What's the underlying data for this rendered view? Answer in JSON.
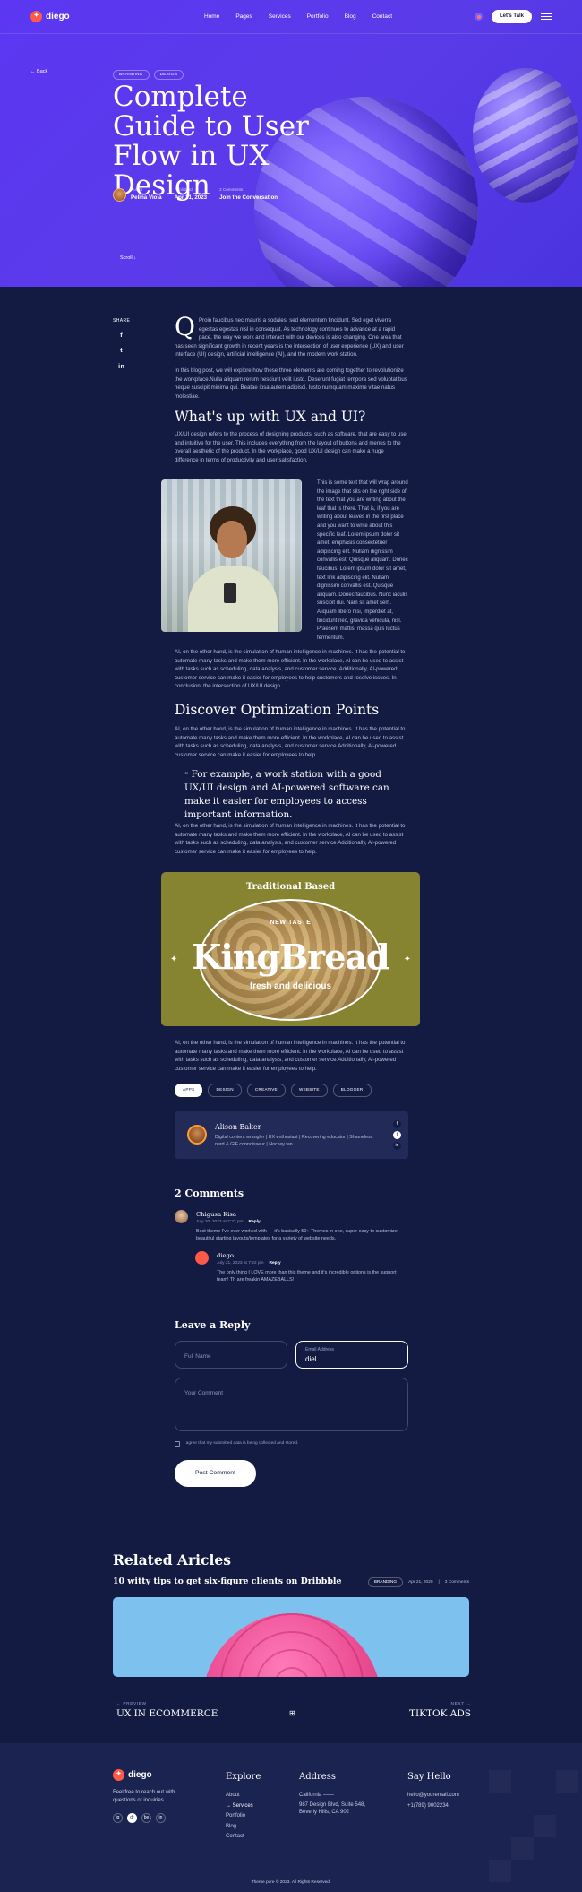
{
  "nav": {
    "logo": "diego",
    "links": [
      "Home",
      "Pages",
      "Services",
      "Portfolio",
      "Blog",
      "Contact"
    ],
    "cta": "Let's Talk"
  },
  "hero": {
    "back": "Back",
    "tags": [
      "BRANDING",
      "DESIGN"
    ],
    "title": "Complete Guide to User Flow in UX Design",
    "author_label": "Author",
    "author": "Pelina Viola",
    "published_label": "Published",
    "published": "Apr 21, 2023",
    "comments_label": "2 Comments",
    "comments_cta": "Join the Conversation",
    "scroll": "Scroll"
  },
  "article": {
    "share_label": "SHARE",
    "intro_dropcap": "Q",
    "intro": "Proin faucibus nec mauris a sodales, sed elementum tincidunt. Sed eget viverra egestas egestas nisl in consequat. As technology continues to advance at a rapid pace, the way we work and interact with our devices is also changing. One area that has seen significant growth in recent years is the intersection of user experience (UX) and user interface (UI) design, artificial intelligence (AI), and the modern work station.",
    "p2": "In this blog post, we will explore how these three elements are coming together to revolutionize the workplace.Nulla aliquam rerum nesciunt velit iusto. Deserunt fugiat tempora sed voluptatibus neque suscipit minima qui. Beatae ipsa autem adipisci. Iusto numquam maxime vitae natus molestiae.",
    "h2_1": "What's up with UX and UI?",
    "p3": "UX/UI design refers to the process of designing products, such as software, that are easy to use and intuitive for the user. This includes everything from the layout of buttons and menus to the overall aesthetic of the product. In the workplace, good UX/UI design can make a huge difference in terms of productivity and user satisfaction.",
    "float_text": "This is some text that will wrap around the image that sits on the right side of the text that you are writing about the leaf that is there. That is, if you are writing about leaves in the first place and you want to write about this specific leaf. Lorem ipsum dolor sit amet, emphasis consectetuer adipiscing elit. Nullam dignissim convallis est. Quisque aliquam. Donec faucibus. Lorem ipsum dolor sit amet, text link adipiscing elit. Nullam dignissim convallis est. Quisque aliquam. Donec faucibus. Nunc iaculis suscipit dui. Nam sit amet sem. Aliquam libero nisi, imperdiet at, tincidunt nec, gravida vehicula, nisl. Praesent mattis, massa quis luctus fermentum.",
    "p4": "AI, on the other hand, is the simulation of human intelligence in machines. It has the potential to automate many tasks and make them more efficient. In the workplace, AI can be used to assist with tasks such as scheduling, data analysis, and customer service. Additionally, AI-powered customer service can make it easier for employees to help customers and resolve issues. In conclusion, the intersection of UX/UI design.",
    "h2_2": "Discover Optimization Points",
    "p5": "AI, on the other hand, is the simulation of human intelligence in machines. It has the potential to automate many tasks and make them more efficient. In the workplace, AI can be used to assist with tasks such as scheduling, data analysis, and customer service.Additionally, AI-powered customer service can make it easier for employees to help.",
    "quote": "For example, a work station with a good UX/UI design and AI-powered software can make it easier for employees to access important information.",
    "p6": "AI, on the other hand, is the simulation of human intelligence in machines. It has the potential to automate many tasks and make them more efficient. In the workplace, AI can be used to assist with tasks such as scheduling, data analysis, and customer service.Additionally, AI-powered customer service can make it easier for employees to help.",
    "banner": {
      "top": "Traditional Based",
      "new_taste": "NEW TASTE",
      "brand": "KingBread",
      "tagline": "fresh and delicious"
    },
    "p7": "AI, on the other hand, is the simulation of human intelligence in machines. It has the potential to automate many tasks and make them more efficient. In the workplace, AI can be used to assist with tasks such as scheduling, data analysis, and customer service.Additionally, AI-powered customer service can make it easier for employees to help.",
    "post_tags": [
      "APPS",
      "DESIGN",
      "CREATIVE",
      "WEBSITE",
      "BLOGGER"
    ]
  },
  "author_box": {
    "name": "Alison Baker",
    "bio": "Digital content wrangler | UX enthusiast | Recovering educator | Shameless nerd & GIF connoisseur | Hockey fan."
  },
  "comments": {
    "heading": "2 Comments",
    "reply_label": "Reply",
    "items": [
      {
        "name": "Chigusa Kisa",
        "date": "July 20, 2023 at 7:22 pm",
        "text": "Best theme I've ever worked with — it's basically 50+ Themes in one, super easy to customize, beautiful starting layouts/templates for a variety of website needs."
      },
      {
        "name": "diego",
        "date": "July 21, 2023 at 7:22 pm",
        "text": "The only thing I LOVE more than this theme and it's incredible options is the support team! Th are freakin AMAZEBALLS!"
      }
    ]
  },
  "reply_form": {
    "heading": "Leave a Reply",
    "name_placeholder": "Full Name",
    "email_label": "Email Address",
    "email_value": "diel",
    "comment_placeholder": "Your Comment",
    "agree": "I agree that my submitted data is being collected and stored.",
    "submit": "Post Comment"
  },
  "related": {
    "heading": "Related Aricles",
    "title": "10 witty tips to get six-figure clients on Dribbble",
    "tag": "BRANDING",
    "date": "Apr 21, 2020",
    "comments": "3 Comments",
    "prev_label": "PREVIEW",
    "prev_title": "UX IN ECOMMERCE",
    "next_label": "NEXT",
    "next_title": "TIKTOK ADS"
  },
  "footer": {
    "logo": "diego",
    "desc": "Feel free to reach out with questions or inquiries.",
    "explore_h": "Explore",
    "explore": [
      "About",
      "Services",
      "Portfolio",
      "Blog",
      "Contact"
    ],
    "address_h": "Address",
    "address": [
      "California ——",
      "987 Design Blvd, Suite 548,",
      "Beverly Hills, CA 902"
    ],
    "hello_h": "Say Hello",
    "hello": [
      "hello@youremail.com",
      "+1(789) 9002234"
    ],
    "copyright": "Theme pure © 2023. All Rights Reserved.",
    "social": [
      "ig",
      "dr",
      "be",
      "in"
    ]
  }
}
